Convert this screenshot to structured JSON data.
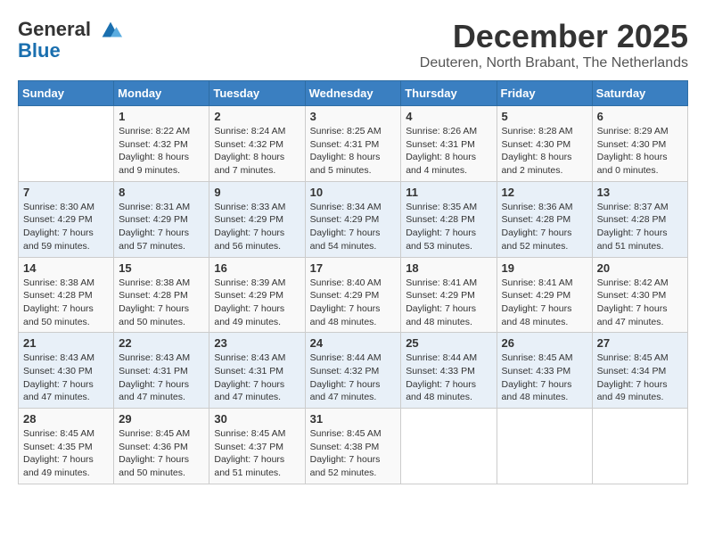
{
  "logo": {
    "line1": "General",
    "line2": "Blue"
  },
  "title": "December 2025",
  "subtitle": "Deuteren, North Brabant, The Netherlands",
  "headers": [
    "Sunday",
    "Monday",
    "Tuesday",
    "Wednesday",
    "Thursday",
    "Friday",
    "Saturday"
  ],
  "weeks": [
    [
      {
        "num": "",
        "sunrise": "",
        "sunset": "",
        "daylight": ""
      },
      {
        "num": "1",
        "sunrise": "Sunrise: 8:22 AM",
        "sunset": "Sunset: 4:32 PM",
        "daylight": "Daylight: 8 hours and 9 minutes."
      },
      {
        "num": "2",
        "sunrise": "Sunrise: 8:24 AM",
        "sunset": "Sunset: 4:32 PM",
        "daylight": "Daylight: 8 hours and 7 minutes."
      },
      {
        "num": "3",
        "sunrise": "Sunrise: 8:25 AM",
        "sunset": "Sunset: 4:31 PM",
        "daylight": "Daylight: 8 hours and 5 minutes."
      },
      {
        "num": "4",
        "sunrise": "Sunrise: 8:26 AM",
        "sunset": "Sunset: 4:31 PM",
        "daylight": "Daylight: 8 hours and 4 minutes."
      },
      {
        "num": "5",
        "sunrise": "Sunrise: 8:28 AM",
        "sunset": "Sunset: 4:30 PM",
        "daylight": "Daylight: 8 hours and 2 minutes."
      },
      {
        "num": "6",
        "sunrise": "Sunrise: 8:29 AM",
        "sunset": "Sunset: 4:30 PM",
        "daylight": "Daylight: 8 hours and 0 minutes."
      }
    ],
    [
      {
        "num": "7",
        "sunrise": "Sunrise: 8:30 AM",
        "sunset": "Sunset: 4:29 PM",
        "daylight": "Daylight: 7 hours and 59 minutes."
      },
      {
        "num": "8",
        "sunrise": "Sunrise: 8:31 AM",
        "sunset": "Sunset: 4:29 PM",
        "daylight": "Daylight: 7 hours and 57 minutes."
      },
      {
        "num": "9",
        "sunrise": "Sunrise: 8:33 AM",
        "sunset": "Sunset: 4:29 PM",
        "daylight": "Daylight: 7 hours and 56 minutes."
      },
      {
        "num": "10",
        "sunrise": "Sunrise: 8:34 AM",
        "sunset": "Sunset: 4:29 PM",
        "daylight": "Daylight: 7 hours and 54 minutes."
      },
      {
        "num": "11",
        "sunrise": "Sunrise: 8:35 AM",
        "sunset": "Sunset: 4:28 PM",
        "daylight": "Daylight: 7 hours and 53 minutes."
      },
      {
        "num": "12",
        "sunrise": "Sunrise: 8:36 AM",
        "sunset": "Sunset: 4:28 PM",
        "daylight": "Daylight: 7 hours and 52 minutes."
      },
      {
        "num": "13",
        "sunrise": "Sunrise: 8:37 AM",
        "sunset": "Sunset: 4:28 PM",
        "daylight": "Daylight: 7 hours and 51 minutes."
      }
    ],
    [
      {
        "num": "14",
        "sunrise": "Sunrise: 8:38 AM",
        "sunset": "Sunset: 4:28 PM",
        "daylight": "Daylight: 7 hours and 50 minutes."
      },
      {
        "num": "15",
        "sunrise": "Sunrise: 8:38 AM",
        "sunset": "Sunset: 4:28 PM",
        "daylight": "Daylight: 7 hours and 50 minutes."
      },
      {
        "num": "16",
        "sunrise": "Sunrise: 8:39 AM",
        "sunset": "Sunset: 4:29 PM",
        "daylight": "Daylight: 7 hours and 49 minutes."
      },
      {
        "num": "17",
        "sunrise": "Sunrise: 8:40 AM",
        "sunset": "Sunset: 4:29 PM",
        "daylight": "Daylight: 7 hours and 48 minutes."
      },
      {
        "num": "18",
        "sunrise": "Sunrise: 8:41 AM",
        "sunset": "Sunset: 4:29 PM",
        "daylight": "Daylight: 7 hours and 48 minutes."
      },
      {
        "num": "19",
        "sunrise": "Sunrise: 8:41 AM",
        "sunset": "Sunset: 4:29 PM",
        "daylight": "Daylight: 7 hours and 48 minutes."
      },
      {
        "num": "20",
        "sunrise": "Sunrise: 8:42 AM",
        "sunset": "Sunset: 4:30 PM",
        "daylight": "Daylight: 7 hours and 47 minutes."
      }
    ],
    [
      {
        "num": "21",
        "sunrise": "Sunrise: 8:43 AM",
        "sunset": "Sunset: 4:30 PM",
        "daylight": "Daylight: 7 hours and 47 minutes."
      },
      {
        "num": "22",
        "sunrise": "Sunrise: 8:43 AM",
        "sunset": "Sunset: 4:31 PM",
        "daylight": "Daylight: 7 hours and 47 minutes."
      },
      {
        "num": "23",
        "sunrise": "Sunrise: 8:43 AM",
        "sunset": "Sunset: 4:31 PM",
        "daylight": "Daylight: 7 hours and 47 minutes."
      },
      {
        "num": "24",
        "sunrise": "Sunrise: 8:44 AM",
        "sunset": "Sunset: 4:32 PM",
        "daylight": "Daylight: 7 hours and 47 minutes."
      },
      {
        "num": "25",
        "sunrise": "Sunrise: 8:44 AM",
        "sunset": "Sunset: 4:33 PM",
        "daylight": "Daylight: 7 hours and 48 minutes."
      },
      {
        "num": "26",
        "sunrise": "Sunrise: 8:45 AM",
        "sunset": "Sunset: 4:33 PM",
        "daylight": "Daylight: 7 hours and 48 minutes."
      },
      {
        "num": "27",
        "sunrise": "Sunrise: 8:45 AM",
        "sunset": "Sunset: 4:34 PM",
        "daylight": "Daylight: 7 hours and 49 minutes."
      }
    ],
    [
      {
        "num": "28",
        "sunrise": "Sunrise: 8:45 AM",
        "sunset": "Sunset: 4:35 PM",
        "daylight": "Daylight: 7 hours and 49 minutes."
      },
      {
        "num": "29",
        "sunrise": "Sunrise: 8:45 AM",
        "sunset": "Sunset: 4:36 PM",
        "daylight": "Daylight: 7 hours and 50 minutes."
      },
      {
        "num": "30",
        "sunrise": "Sunrise: 8:45 AM",
        "sunset": "Sunset: 4:37 PM",
        "daylight": "Daylight: 7 hours and 51 minutes."
      },
      {
        "num": "31",
        "sunrise": "Sunrise: 8:45 AM",
        "sunset": "Sunset: 4:38 PM",
        "daylight": "Daylight: 7 hours and 52 minutes."
      },
      {
        "num": "",
        "sunrise": "",
        "sunset": "",
        "daylight": ""
      },
      {
        "num": "",
        "sunrise": "",
        "sunset": "",
        "daylight": ""
      },
      {
        "num": "",
        "sunrise": "",
        "sunset": "",
        "daylight": ""
      }
    ]
  ]
}
